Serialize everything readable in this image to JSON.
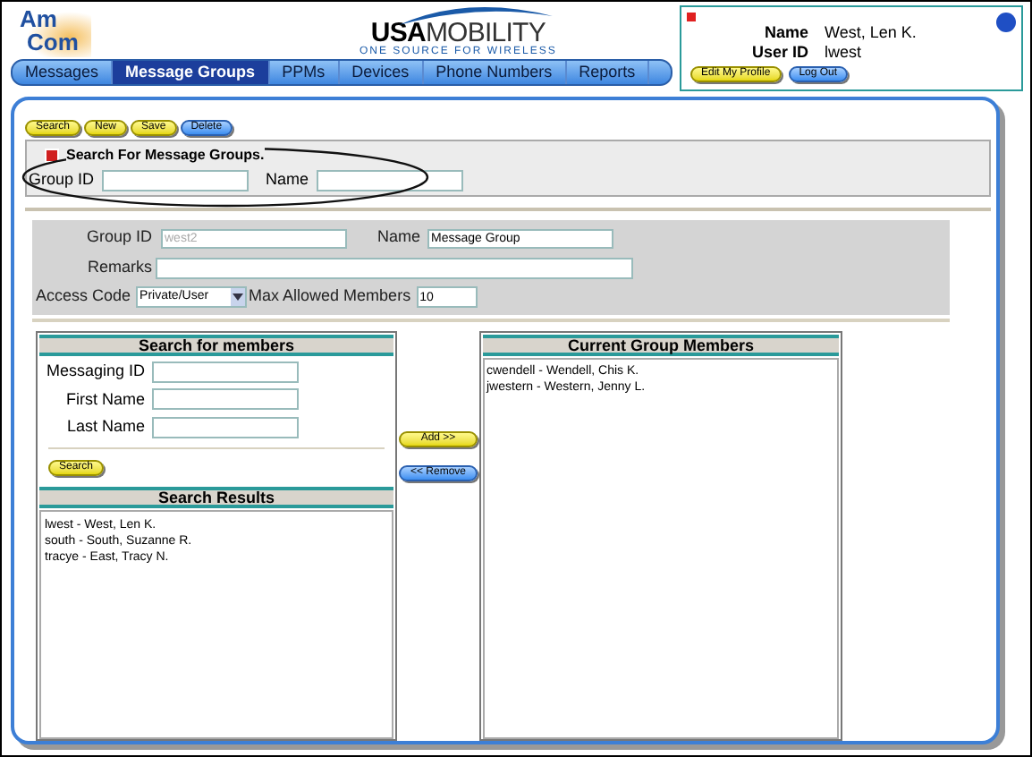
{
  "logo": {
    "top": "Am",
    "bottom": "Com"
  },
  "brand": {
    "name_bold": "USA",
    "name_light": "MOBILITY",
    "tagline": "ONE SOURCE FOR WIRELESS"
  },
  "user_panel": {
    "fields": [
      {
        "label": "Name",
        "value": "West, Len K."
      },
      {
        "label": "User ID",
        "value": "lwest"
      }
    ],
    "buttons": [
      {
        "label": "Edit My Profile",
        "kind": "yellow"
      },
      {
        "label": "Log Out",
        "kind": "blue"
      }
    ]
  },
  "nav": [
    {
      "label": "Messages",
      "selected": false
    },
    {
      "label": "Message Groups",
      "selected": true
    },
    {
      "label": "PPMs",
      "selected": false
    },
    {
      "label": "Devices",
      "selected": false
    },
    {
      "label": "Phone Numbers",
      "selected": false
    },
    {
      "label": "Reports",
      "selected": false
    }
  ],
  "toolbar": [
    {
      "label": "Search",
      "kind": "yellow"
    },
    {
      "label": "New",
      "kind": "yellow"
    },
    {
      "label": "Save",
      "kind": "yellow"
    },
    {
      "label": "Delete",
      "kind": "blue"
    }
  ],
  "search_section": {
    "title": "Search For Message Groups.",
    "fields": [
      {
        "label": "Group ID"
      },
      {
        "label": "Name"
      }
    ]
  },
  "group_form": {
    "group_id": {
      "label": "Group ID",
      "value": "west2",
      "disabled": true
    },
    "name": {
      "label": "Name",
      "value": "Message Group"
    },
    "remarks": {
      "label": "Remarks"
    },
    "access_code": {
      "label": "Access Code",
      "value": "Private/User"
    },
    "max_members": {
      "label": "Max Allowed Members",
      "value": "10"
    }
  },
  "member_search": {
    "title": "Search for members",
    "fields": [
      {
        "label": "Messaging ID"
      },
      {
        "label": "First Name"
      },
      {
        "label": "Last Name"
      }
    ],
    "button": "Search"
  },
  "search_results": {
    "title": "Search Results",
    "items": [
      "lwest - West, Len K.",
      "south - South, Suzanne R.",
      "tracye - East, Tracy N."
    ]
  },
  "transfer_buttons": [
    {
      "label": "Add >>",
      "kind": "yellow"
    },
    {
      "label": "<< Remove",
      "kind": "blue"
    }
  ],
  "current_members": {
    "title": "Current Group Members",
    "items": [
      "cwendell - Wendell, Chis K.",
      "jwestern - Western, Jenny L."
    ]
  }
}
